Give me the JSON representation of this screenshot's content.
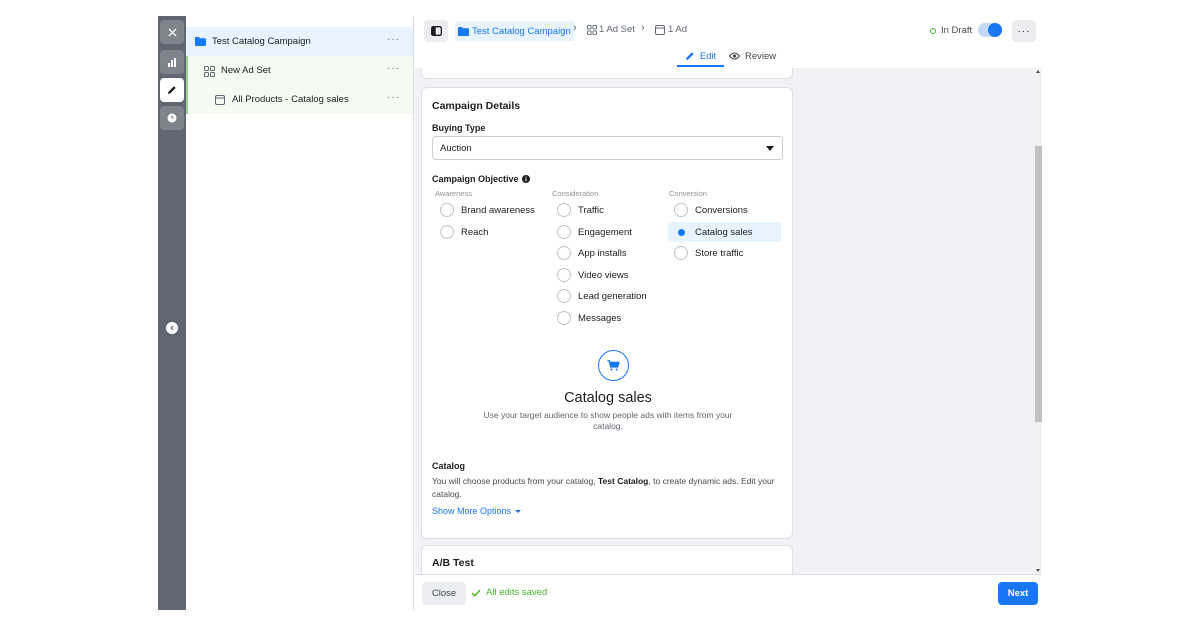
{
  "colors": {
    "accent": "#1877f2",
    "success": "#42b72a",
    "rail": "#606770"
  },
  "rail": {
    "icons": [
      "close-icon",
      "chart-icon",
      "pencil-icon",
      "clock-icon",
      "chevron-left-icon"
    ]
  },
  "tree": {
    "items": [
      {
        "label": "Test Catalog Campaign",
        "icon": "folder-icon",
        "menu": "···"
      },
      {
        "label": "New Ad Set",
        "icon": "grid-icon",
        "menu": "···"
      },
      {
        "label": "All Products - Catalog sales",
        "icon": "ad-icon",
        "menu": "···"
      }
    ]
  },
  "topbar": {
    "breadcrumb": {
      "campaign": "Test Catalog Campaign",
      "adset": "1 Ad Set",
      "ad": "1 Ad"
    },
    "status": "In Draft",
    "more": "···",
    "tabs": {
      "edit": "Edit",
      "review": "Review"
    }
  },
  "details": {
    "title": "Campaign Details",
    "buying_type_label": "Buying Type",
    "buying_type_value": "Auction",
    "objective_label": "Campaign Objective",
    "columns": [
      {
        "heading": "Awareness",
        "options": [
          "Brand awareness",
          "Reach"
        ]
      },
      {
        "heading": "Consideration",
        "options": [
          "Traffic",
          "Engagement",
          "App installs",
          "Video views",
          "Lead generation",
          "Messages"
        ]
      },
      {
        "heading": "Conversion",
        "options": [
          "Conversions",
          "Catalog sales",
          "Store traffic"
        ]
      }
    ],
    "selected_objective": "Catalog sales",
    "objective_title": "Catalog sales",
    "objective_description": "Use your target audience to show people ads with items from your catalog.",
    "catalog_label": "Catalog",
    "catalog_text_pre": "You will choose products from your catalog, ",
    "catalog_name": "Test Catalog",
    "catalog_text_post": ", to create dynamic ads. Edit your catalog.",
    "show_more": "Show More Options"
  },
  "ab_test": {
    "title": "A/B Test"
  },
  "footer": {
    "close": "Close",
    "saved": "All edits saved",
    "next": "Next"
  }
}
